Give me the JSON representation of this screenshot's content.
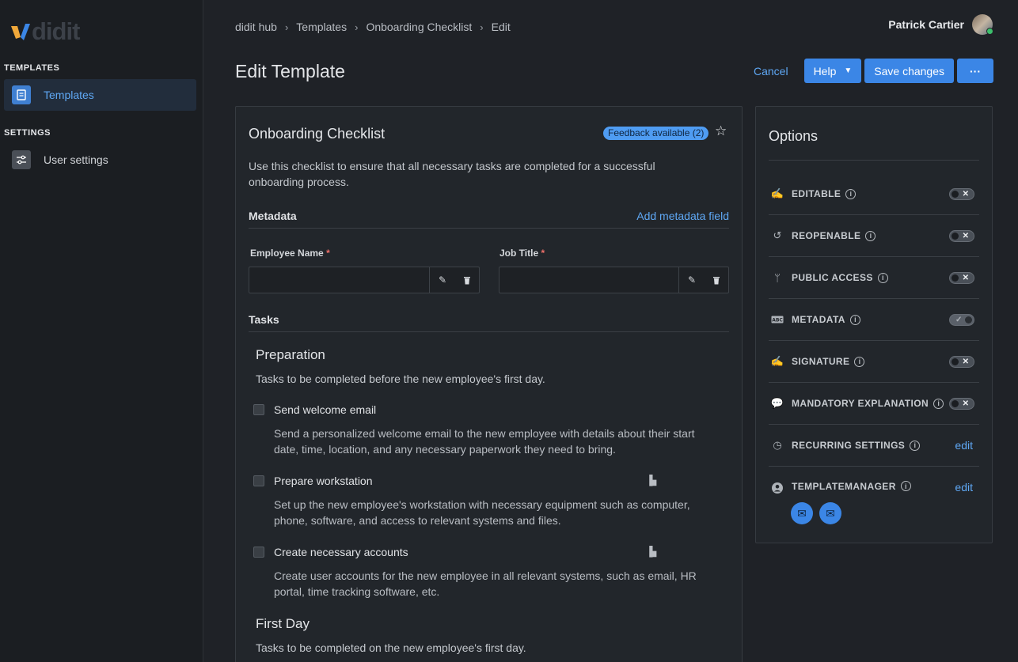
{
  "app": {
    "logo_text": "didit"
  },
  "sidebar": {
    "sections": [
      {
        "title": "TEMPLATES",
        "items": [
          {
            "label": "Templates",
            "icon": "document-icon",
            "active": true
          }
        ]
      },
      {
        "title": "SETTINGS",
        "items": [
          {
            "label": "User settings",
            "icon": "sliders-icon",
            "active": false
          }
        ]
      }
    ]
  },
  "breadcrumb": [
    "didit hub",
    "Templates",
    "Onboarding Checklist",
    "Edit"
  ],
  "user": {
    "name": "Patrick Cartier"
  },
  "page": {
    "title": "Edit Template"
  },
  "actions": {
    "cancel": "Cancel",
    "help": "Help",
    "save": "Save changes",
    "more": "···"
  },
  "template": {
    "title": "Onboarding Checklist",
    "feedback_badge": "Feedback available (2)",
    "description": "Use this checklist to ensure that all necessary tasks are completed for a successful onboarding process.",
    "metadata_heading": "Metadata",
    "add_metadata": "Add metadata field",
    "fields": [
      {
        "label": "Employee Name",
        "required_mark": "*",
        "value": ""
      },
      {
        "label": "Job Title",
        "required_mark": "*",
        "value": ""
      }
    ],
    "tasks_heading": "Tasks",
    "groups": [
      {
        "title": "Preparation",
        "description": "Tasks to be completed before the new employee's first day.",
        "tasks": [
          {
            "name": "Send welcome email",
            "description": "Send a personalized welcome email to the new employee with details about their start date, time, location, and any necessary paperwork they need to bring."
          },
          {
            "name": "Prepare workstation",
            "description": "Set up the new employee's workstation with necessary equipment such as computer, phone, software, and access to relevant systems and files."
          },
          {
            "name": "Create necessary accounts",
            "description": "Create user accounts for the new employee in all relevant systems, such as email, HR portal, time tracking software, etc."
          }
        ]
      },
      {
        "title": "First Day",
        "description": "Tasks to be completed on the new employee's first day."
      }
    ]
  },
  "options": {
    "title": "Options",
    "items": [
      {
        "label": "EDITABLE",
        "icon": "pen-icon",
        "control": "toggle",
        "enabled": false
      },
      {
        "label": "REOPENABLE",
        "icon": "reopen-icon",
        "control": "toggle",
        "enabled": false
      },
      {
        "label": "PUBLIC ACCESS",
        "icon": "branch-icon",
        "control": "toggle",
        "enabled": false
      },
      {
        "label": "METADATA",
        "icon": "abc-icon",
        "control": "toggle",
        "enabled": true
      },
      {
        "label": "SIGNATURE",
        "icon": "signature-icon",
        "control": "toggle",
        "enabled": false
      },
      {
        "label": "MANDATORY EXPLANATION",
        "icon": "comment-icon",
        "control": "toggle",
        "enabled": false
      },
      {
        "label": "RECURRING SETTINGS",
        "icon": "clock-icon",
        "control": "edit",
        "edit_label": "edit"
      },
      {
        "label": "TEMPLATEMANAGER",
        "icon": "person-icon",
        "control": "edit",
        "edit_label": "edit"
      }
    ]
  },
  "colors": {
    "accent": "#3b86e6",
    "link": "#5fa8f5",
    "background": "#1f2227",
    "card": "#22262b"
  }
}
